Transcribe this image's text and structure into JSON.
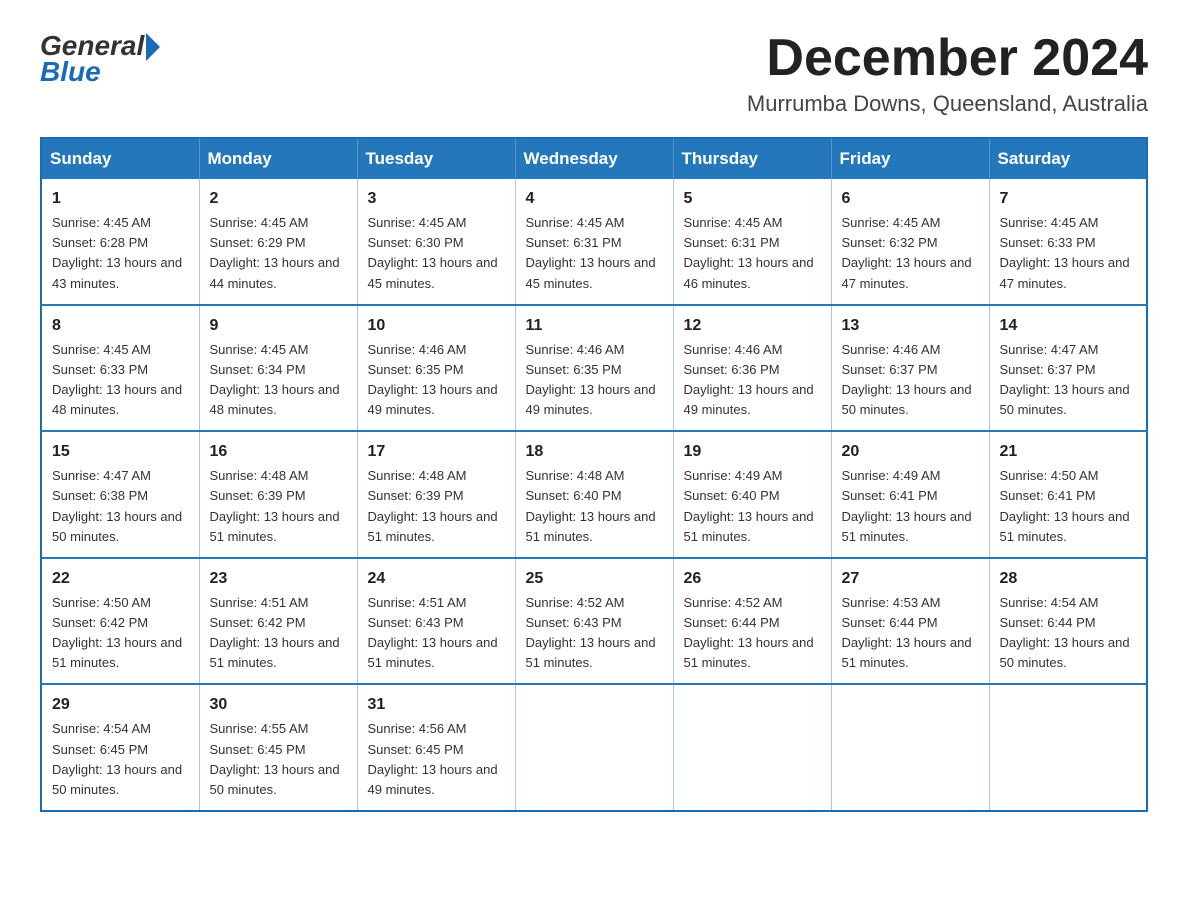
{
  "header": {
    "logo_general": "General",
    "logo_blue": "Blue",
    "month_title": "December 2024",
    "location": "Murrumba Downs, Queensland, Australia"
  },
  "weekdays": [
    "Sunday",
    "Monday",
    "Tuesday",
    "Wednesday",
    "Thursday",
    "Friday",
    "Saturday"
  ],
  "weeks": [
    [
      {
        "day": "1",
        "sunrise": "4:45 AM",
        "sunset": "6:28 PM",
        "daylight": "13 hours and 43 minutes."
      },
      {
        "day": "2",
        "sunrise": "4:45 AM",
        "sunset": "6:29 PM",
        "daylight": "13 hours and 44 minutes."
      },
      {
        "day": "3",
        "sunrise": "4:45 AM",
        "sunset": "6:30 PM",
        "daylight": "13 hours and 45 minutes."
      },
      {
        "day": "4",
        "sunrise": "4:45 AM",
        "sunset": "6:31 PM",
        "daylight": "13 hours and 45 minutes."
      },
      {
        "day": "5",
        "sunrise": "4:45 AM",
        "sunset": "6:31 PM",
        "daylight": "13 hours and 46 minutes."
      },
      {
        "day": "6",
        "sunrise": "4:45 AM",
        "sunset": "6:32 PM",
        "daylight": "13 hours and 47 minutes."
      },
      {
        "day": "7",
        "sunrise": "4:45 AM",
        "sunset": "6:33 PM",
        "daylight": "13 hours and 47 minutes."
      }
    ],
    [
      {
        "day": "8",
        "sunrise": "4:45 AM",
        "sunset": "6:33 PM",
        "daylight": "13 hours and 48 minutes."
      },
      {
        "day": "9",
        "sunrise": "4:45 AM",
        "sunset": "6:34 PM",
        "daylight": "13 hours and 48 minutes."
      },
      {
        "day": "10",
        "sunrise": "4:46 AM",
        "sunset": "6:35 PM",
        "daylight": "13 hours and 49 minutes."
      },
      {
        "day": "11",
        "sunrise": "4:46 AM",
        "sunset": "6:35 PM",
        "daylight": "13 hours and 49 minutes."
      },
      {
        "day": "12",
        "sunrise": "4:46 AM",
        "sunset": "6:36 PM",
        "daylight": "13 hours and 49 minutes."
      },
      {
        "day": "13",
        "sunrise": "4:46 AM",
        "sunset": "6:37 PM",
        "daylight": "13 hours and 50 minutes."
      },
      {
        "day": "14",
        "sunrise": "4:47 AM",
        "sunset": "6:37 PM",
        "daylight": "13 hours and 50 minutes."
      }
    ],
    [
      {
        "day": "15",
        "sunrise": "4:47 AM",
        "sunset": "6:38 PM",
        "daylight": "13 hours and 50 minutes."
      },
      {
        "day": "16",
        "sunrise": "4:48 AM",
        "sunset": "6:39 PM",
        "daylight": "13 hours and 51 minutes."
      },
      {
        "day": "17",
        "sunrise": "4:48 AM",
        "sunset": "6:39 PM",
        "daylight": "13 hours and 51 minutes."
      },
      {
        "day": "18",
        "sunrise": "4:48 AM",
        "sunset": "6:40 PM",
        "daylight": "13 hours and 51 minutes."
      },
      {
        "day": "19",
        "sunrise": "4:49 AM",
        "sunset": "6:40 PM",
        "daylight": "13 hours and 51 minutes."
      },
      {
        "day": "20",
        "sunrise": "4:49 AM",
        "sunset": "6:41 PM",
        "daylight": "13 hours and 51 minutes."
      },
      {
        "day": "21",
        "sunrise": "4:50 AM",
        "sunset": "6:41 PM",
        "daylight": "13 hours and 51 minutes."
      }
    ],
    [
      {
        "day": "22",
        "sunrise": "4:50 AM",
        "sunset": "6:42 PM",
        "daylight": "13 hours and 51 minutes."
      },
      {
        "day": "23",
        "sunrise": "4:51 AM",
        "sunset": "6:42 PM",
        "daylight": "13 hours and 51 minutes."
      },
      {
        "day": "24",
        "sunrise": "4:51 AM",
        "sunset": "6:43 PM",
        "daylight": "13 hours and 51 minutes."
      },
      {
        "day": "25",
        "sunrise": "4:52 AM",
        "sunset": "6:43 PM",
        "daylight": "13 hours and 51 minutes."
      },
      {
        "day": "26",
        "sunrise": "4:52 AM",
        "sunset": "6:44 PM",
        "daylight": "13 hours and 51 minutes."
      },
      {
        "day": "27",
        "sunrise": "4:53 AM",
        "sunset": "6:44 PM",
        "daylight": "13 hours and 51 minutes."
      },
      {
        "day": "28",
        "sunrise": "4:54 AM",
        "sunset": "6:44 PM",
        "daylight": "13 hours and 50 minutes."
      }
    ],
    [
      {
        "day": "29",
        "sunrise": "4:54 AM",
        "sunset": "6:45 PM",
        "daylight": "13 hours and 50 minutes."
      },
      {
        "day": "30",
        "sunrise": "4:55 AM",
        "sunset": "6:45 PM",
        "daylight": "13 hours and 50 minutes."
      },
      {
        "day": "31",
        "sunrise": "4:56 AM",
        "sunset": "6:45 PM",
        "daylight": "13 hours and 49 minutes."
      },
      {
        "day": "",
        "sunrise": "",
        "sunset": "",
        "daylight": ""
      },
      {
        "day": "",
        "sunrise": "",
        "sunset": "",
        "daylight": ""
      },
      {
        "day": "",
        "sunrise": "",
        "sunset": "",
        "daylight": ""
      },
      {
        "day": "",
        "sunrise": "",
        "sunset": "",
        "daylight": ""
      }
    ]
  ]
}
